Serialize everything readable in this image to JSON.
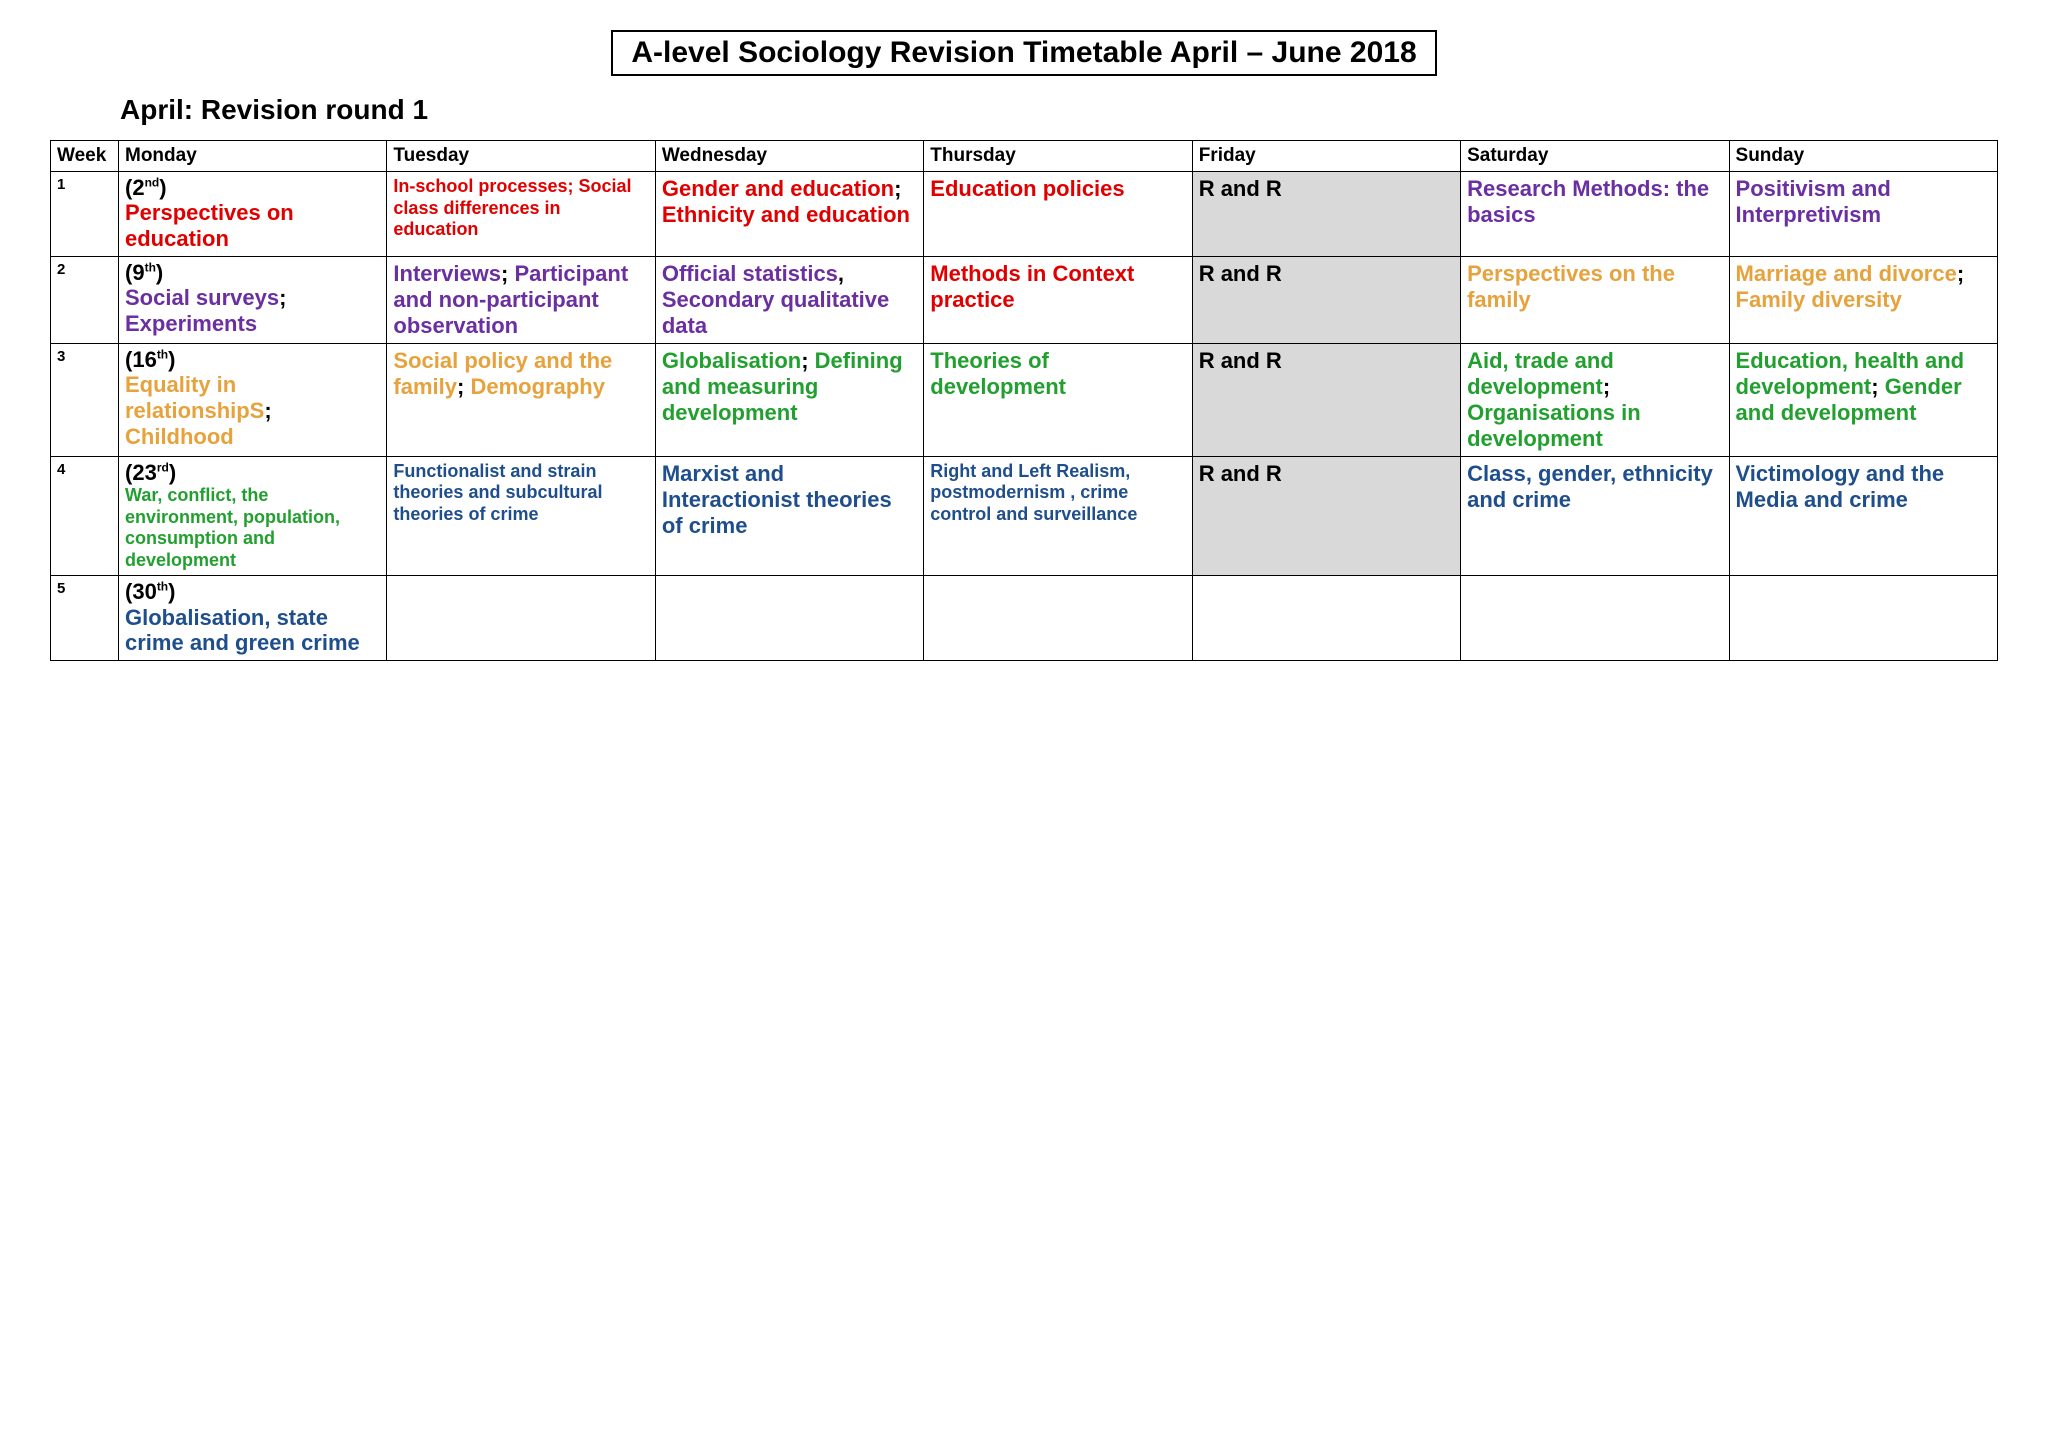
{
  "title": "A-level Sociology Revision Timetable April – June 2018",
  "subtitle": "April: Revision round 1",
  "headers": {
    "week": "Week",
    "mon": "Monday",
    "tue": "Tuesday",
    "wed": "Wednesday",
    "thu": "Thursday",
    "fri": "Friday",
    "sat": "Saturday",
    "sun": "Sunday"
  },
  "r_and_r": "R and R",
  "weeks": {
    "w1": {
      "num": "1",
      "date_num": "2",
      "date_suf": "nd",
      "mon": "Perspectives on education",
      "tue": "In-school processes; Social class differences in education",
      "wed_a": "Gender and education",
      "wed_b": "Ethnicity and education",
      "thu": "Education policies",
      "sat": "Research Methods: the basics",
      "sun": "Positivism and Interpretivism"
    },
    "w2": {
      "num": "2",
      "date_num": "9",
      "date_suf": "th",
      "mon_a": "Social surveys",
      "mon_b": "Experiments",
      "tue_a": "Interviews",
      "tue_b": "Participant and non-participant observation",
      "wed_a": "Official statistics",
      "wed_b": "Secondary qualitative data",
      "thu": "Methods in Context practice",
      "sat": "Perspectives on the family",
      "sun_a": "Marriage and divorce",
      "sun_b": "Family diversity"
    },
    "w3": {
      "num": "3",
      "date_num": "16",
      "date_suf": "th",
      "mon_a": "Equality in relationshipS",
      "mon_b": "Childhood",
      "tue_a": "Social policy and the family",
      "tue_b": "Demography",
      "wed_a": "Globalisation",
      "wed_b": "Defining and measuring development",
      "thu": "Theories of development",
      "sat_a": "Aid, trade and development",
      "sat_b": "Organisations in development",
      "sun_a": "Education, health and development",
      "sun_b": "Gender and development"
    },
    "w4": {
      "num": "4",
      "date_num": "23",
      "date_suf": "rd",
      "mon": "War, conflict, the environment, population, consumption and development",
      "tue": "Functionalist and strain theories and subcultural theories of crime",
      "wed": "Marxist and Interactionist theories of crime",
      "thu": "Right and Left Realism, postmodernism , crime control and surveillance",
      "sat": "Class, gender, ethnicity and crime",
      "sun": "Victimology and the Media and crime"
    },
    "w5": {
      "num": "5",
      "date_num": "30",
      "date_suf": "th",
      "mon": "Globalisation, state crime and green crime"
    }
  }
}
